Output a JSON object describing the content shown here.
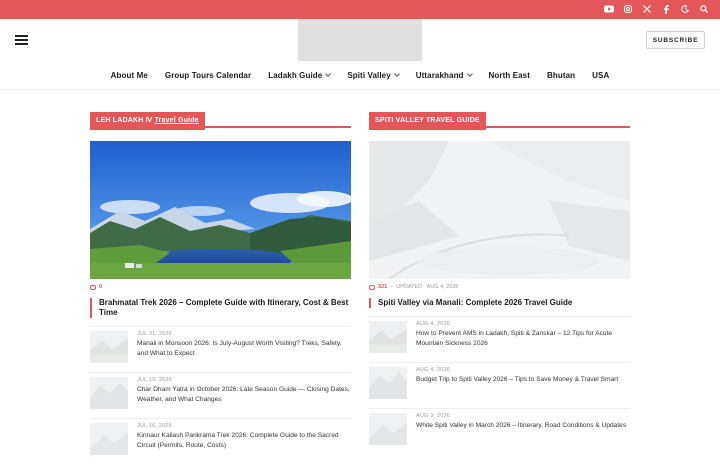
{
  "colors": {
    "accent": "#e45759"
  },
  "topbar": {
    "icons": [
      "youtube-icon",
      "instagram-icon",
      "x-icon",
      "facebook-icon",
      "moon-icon",
      "search-icon"
    ]
  },
  "header": {
    "subscribe_label": "SUBSCRIBE"
  },
  "nav": {
    "items": [
      {
        "label": "About Me",
        "dropdown": false
      },
      {
        "label": "Group Tours Calendar",
        "dropdown": false
      },
      {
        "label": "Ladakh Guide",
        "dropdown": true
      },
      {
        "label": "Spiti Valley",
        "dropdown": true
      },
      {
        "label": "Uttarakhand",
        "dropdown": true
      },
      {
        "label": "North East",
        "dropdown": false
      },
      {
        "label": "Bhutan",
        "dropdown": false
      },
      {
        "label": "USA",
        "dropdown": false
      }
    ]
  },
  "left": {
    "tag_prefix": "LEH LADAKH Ⅳ",
    "tag_link": "Travel Guide",
    "featured": {
      "comments": "0",
      "title": "Brahmatal Trek 2026 – Complete Guide with Itinerary, Cost & Best Time"
    },
    "posts": [
      {
        "date": "JUL 31, 2026",
        "title": "Manali in Monsoon 2026: Is July-August Worth Visiting? Treks, Safety, and What to Expect"
      },
      {
        "date": "JUL 19, 2026",
        "title": "Char Dham Yatra in October 2026: Late Season Guide — Closing Dates, Weather, and What Changes"
      },
      {
        "date": "JUL 16, 2026",
        "title": "Kinnaur Kailash Parikrama Trek 2026: Complete Guide to the Sacred Circuit (Permits, Route, Costs)"
      }
    ]
  },
  "right": {
    "tag": "SPITI VALLEY TRAVEL GUIDE",
    "featured": {
      "comments": "321",
      "updated": "UPDATED:",
      "date": "AUG 4, 2026",
      "title": "Spiti Valley via Manali: Complete 2026 Travel Guide"
    },
    "posts": [
      {
        "date": "AUG 4, 2026",
        "title": "How to Prevent AMS in Ladakh, Spiti & Zanskar – 12 Tips for Acute Mountain Sickness 2026"
      },
      {
        "date": "AUG 4, 2026",
        "title": "Budget Trip to Spiti Valley 2026 – Tips to Save Money & Travel Smart"
      },
      {
        "date": "AUG 3, 2026",
        "title": "White Spiti Valley in March 2026 – Itinerary, Road Conditions & Updates"
      }
    ]
  }
}
